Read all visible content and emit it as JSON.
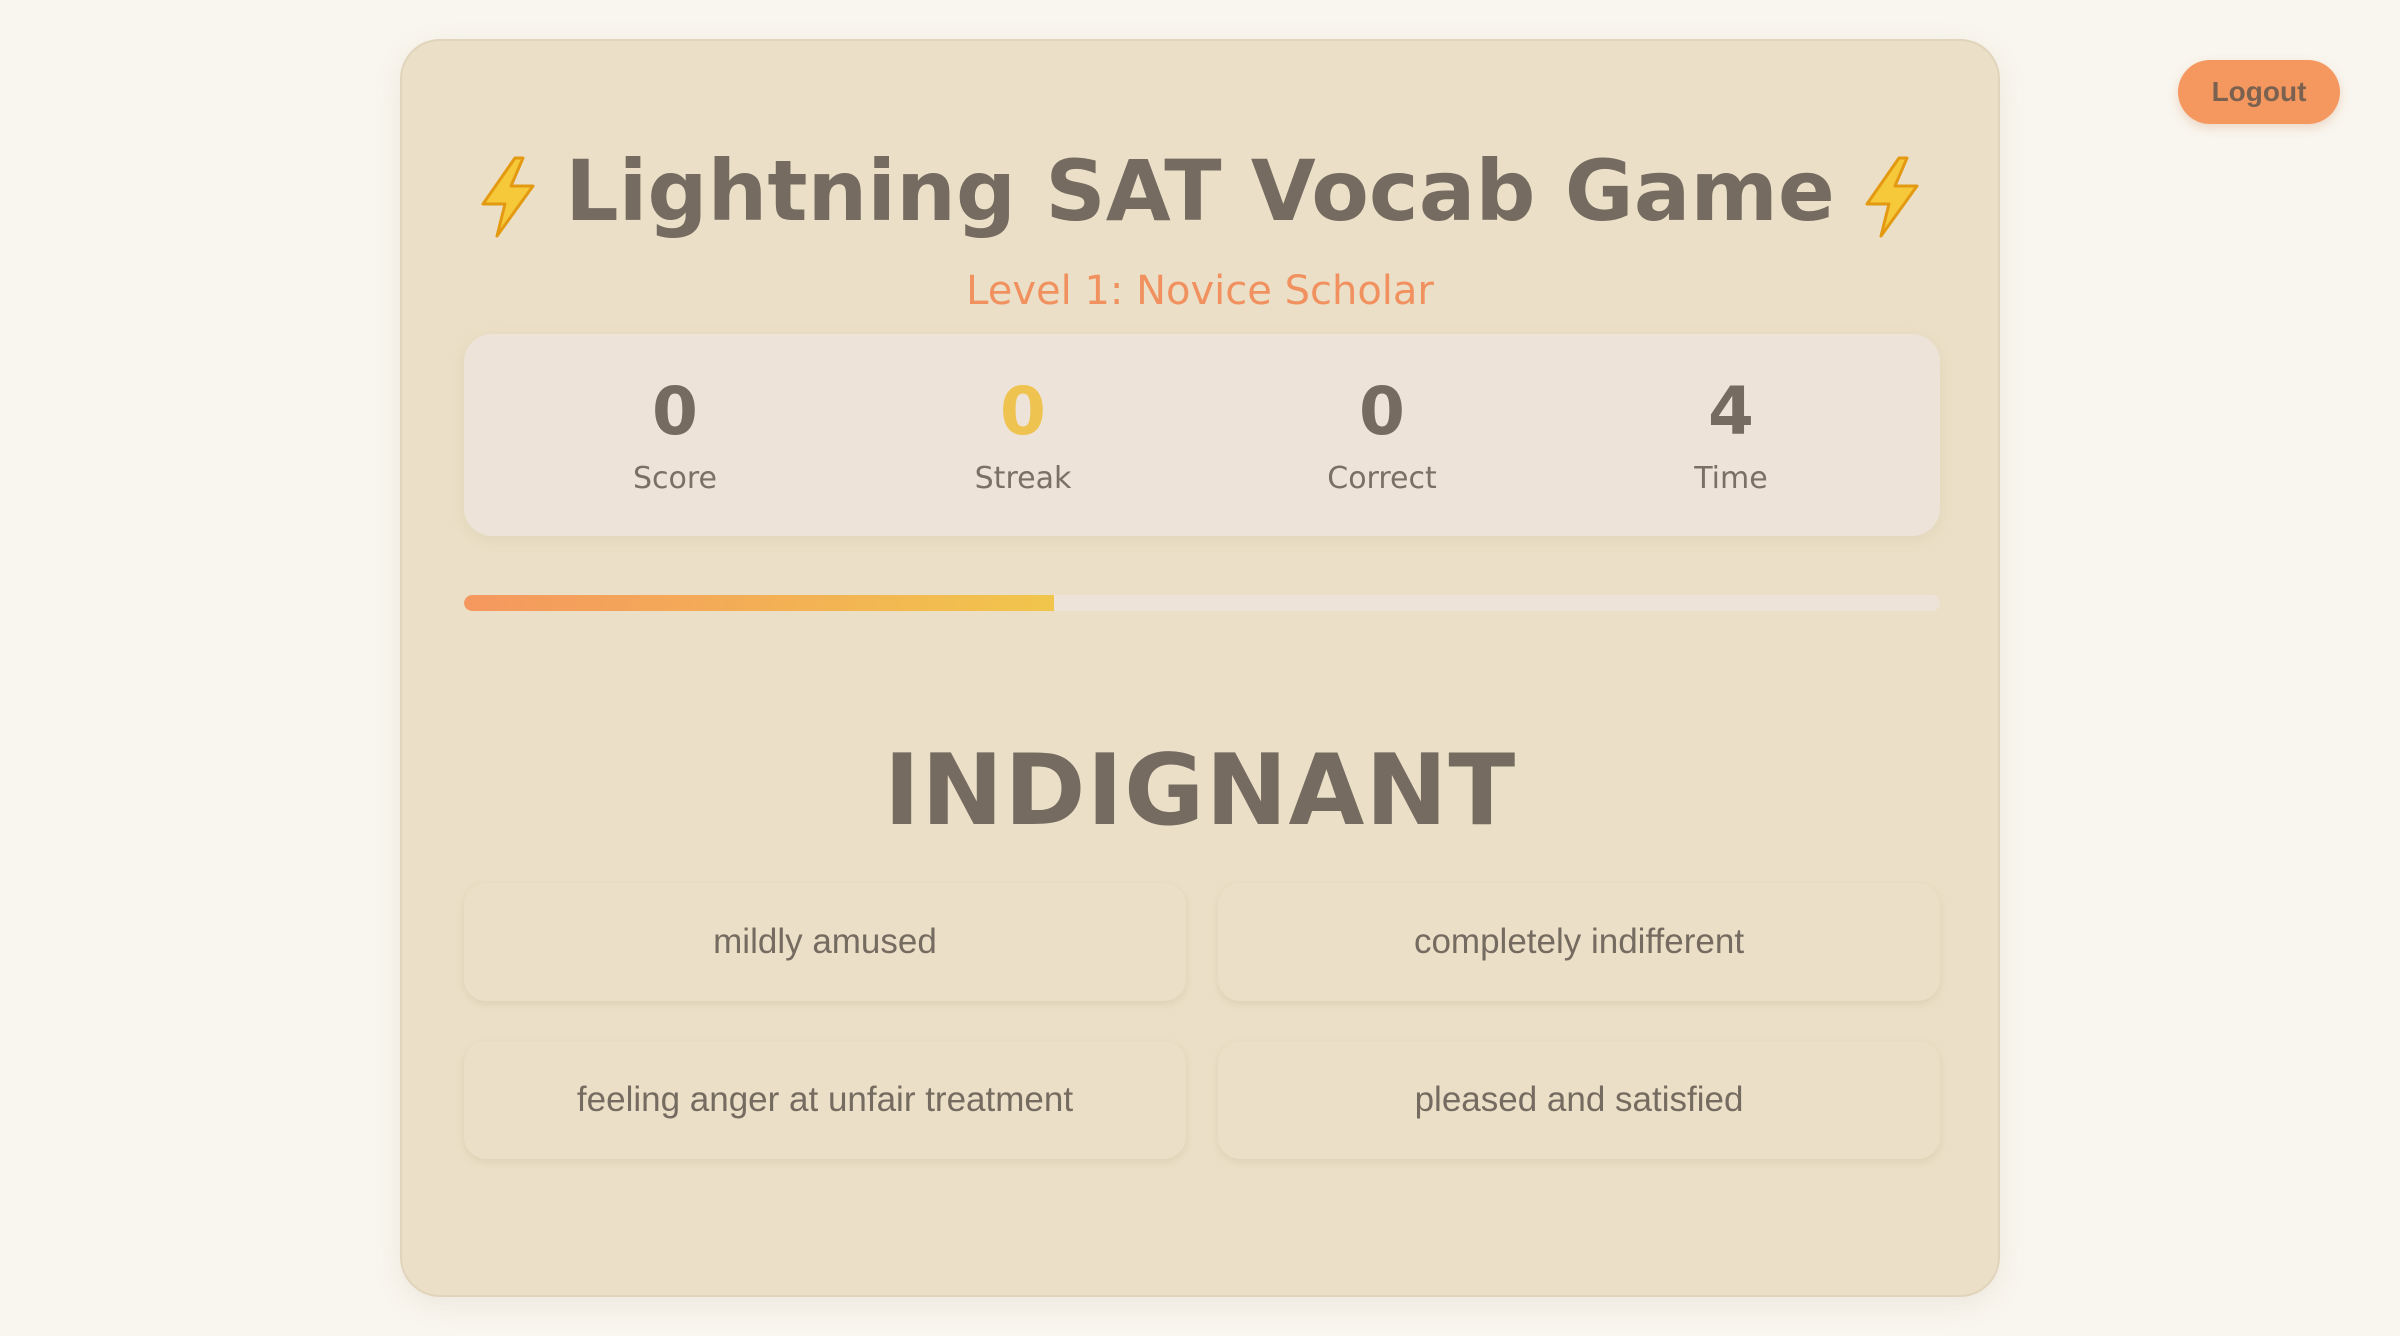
{
  "header": {
    "logout_label": "Logout"
  },
  "game": {
    "title": "Lightning SAT Vocab Game",
    "title_icon": "lightning-bolt-icon",
    "level": "Level 1: Novice Scholar",
    "stats": {
      "score": {
        "value": "0",
        "label": "Score"
      },
      "streak": {
        "value": "0",
        "label": "Streak"
      },
      "correct": {
        "value": "0",
        "label": "Correct"
      },
      "time": {
        "value": "4",
        "label": "Time"
      }
    },
    "timer_progress_percent": 40,
    "word": "INDIGNANT",
    "options": [
      "mildly amused",
      "completely indifferent",
      "feeling anger at unfair treatment",
      "pleased and satisfied"
    ]
  },
  "colors": {
    "background": "#f9f6ef",
    "card": "#ebe0c7",
    "accent_orange": "#f5985f",
    "accent_yellow": "#f1c54c",
    "text": "#756b60"
  }
}
